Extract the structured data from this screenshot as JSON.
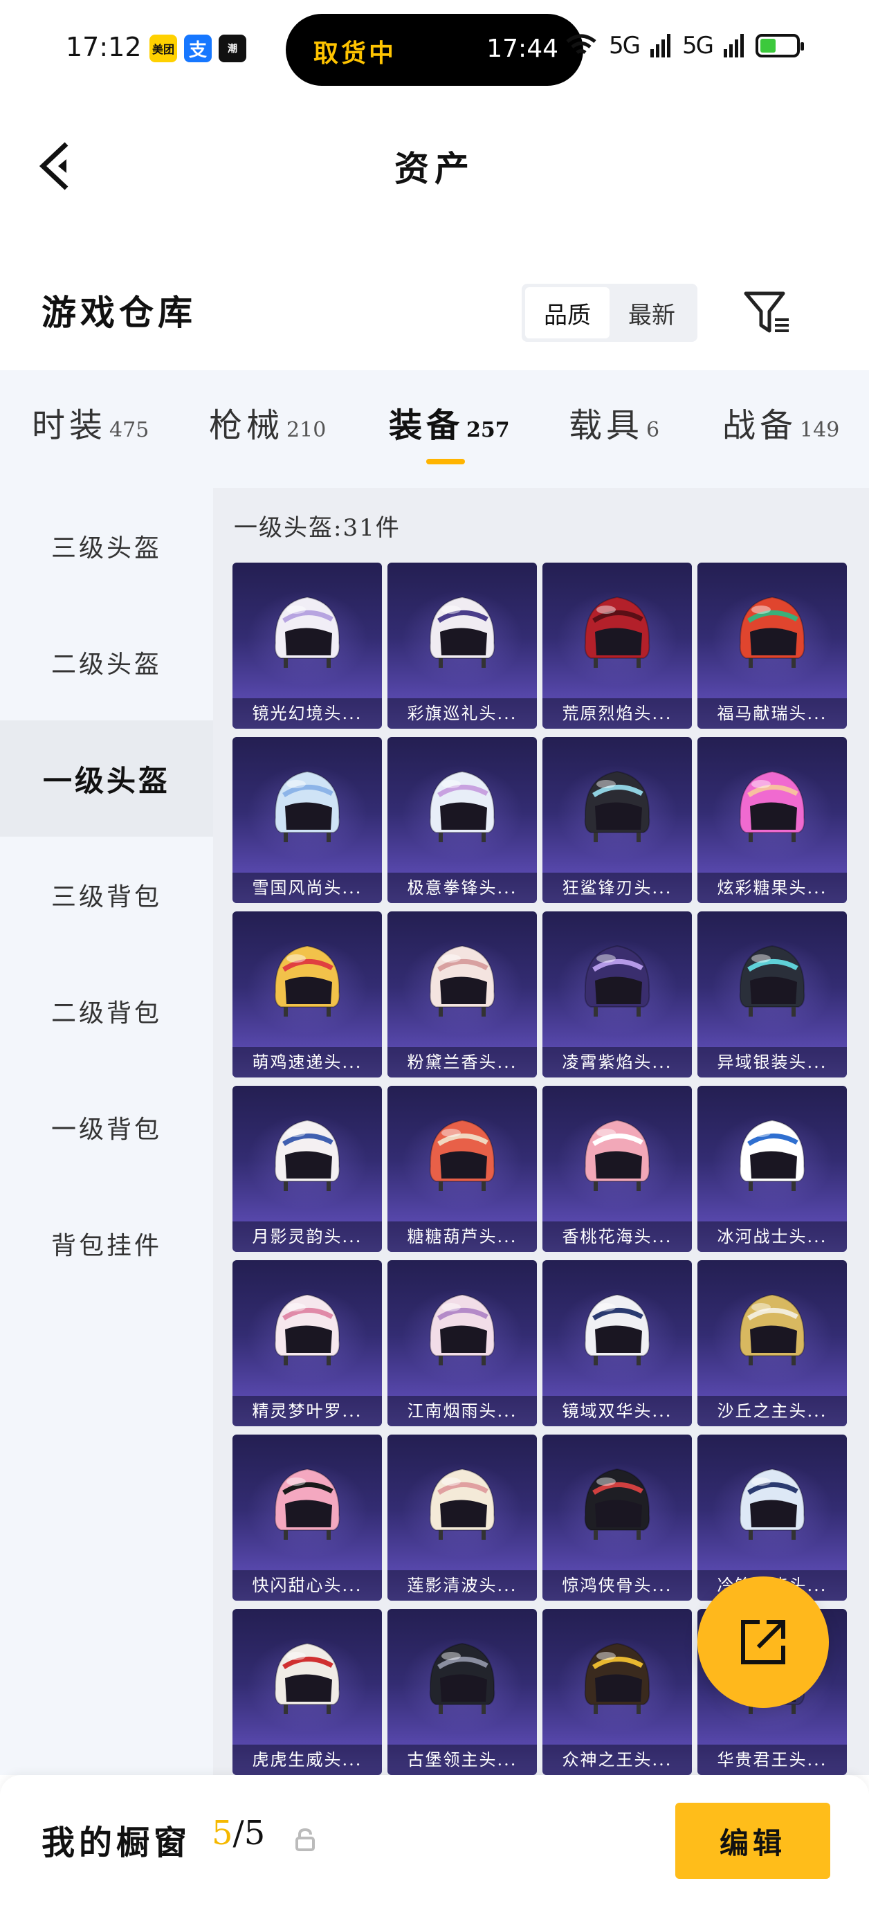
{
  "status_bar": {
    "time": "17:12",
    "badges": [
      "美团",
      "支",
      "潮"
    ],
    "pill_label": "取货中",
    "pill_time": "17:44",
    "signal_1": "5G",
    "signal_2": "5G"
  },
  "nav": {
    "title": "资产"
  },
  "section": {
    "title": "游戏仓库",
    "sort_options": [
      {
        "label": "品质",
        "active": true
      },
      {
        "label": "最新",
        "active": false
      }
    ]
  },
  "tabs": [
    {
      "name": "时装",
      "count": "475"
    },
    {
      "name": "枪械",
      "count": "210"
    },
    {
      "name": "装备",
      "count": "257",
      "active": true
    },
    {
      "name": "载具",
      "count": "6"
    },
    {
      "name": "战备",
      "count": "149"
    }
  ],
  "sidebar": [
    {
      "label": "三级头盔"
    },
    {
      "label": "二级头盔"
    },
    {
      "label": "一级头盔",
      "active": true
    },
    {
      "label": "三级背包"
    },
    {
      "label": "二级背包"
    },
    {
      "label": "一级背包"
    },
    {
      "label": "背包挂件"
    }
  ],
  "grid": {
    "label": "一级头盔:31件",
    "items": [
      {
        "name": "镜光幻境头...",
        "color": "#f1eef6",
        "accent": "#b7a4e0"
      },
      {
        "name": "彩旗巡礼头...",
        "color": "#f0ecf2",
        "accent": "#4a3d8a"
      },
      {
        "name": "荒原烈焰头...",
        "color": "#b3202a",
        "accent": "#5a0f16"
      },
      {
        "name": "福马献瑞头...",
        "color": "#e0452e",
        "accent": "#3ab07a"
      },
      {
        "name": "雪国风尚头...",
        "color": "#cfe3f6",
        "accent": "#8db4e8"
      },
      {
        "name": "极意拳锋头...",
        "color": "#e8eef8",
        "accent": "#c8a2e0"
      },
      {
        "name": "狂鲨锋刃头...",
        "color": "#2b2b33",
        "accent": "#8fd0e0"
      },
      {
        "name": "炫彩糖果头...",
        "color": "#f06ad0",
        "accent": "#f7c0a0"
      },
      {
        "name": "萌鸡速递头...",
        "color": "#f2c24a",
        "accent": "#e04040"
      },
      {
        "name": "粉黛兰香头...",
        "color": "#f4e4e0",
        "accent": "#d8a0a0"
      },
      {
        "name": "凌霄紫焰头...",
        "color": "#3a2e6e",
        "accent": "#b59ae8"
      },
      {
        "name": "异域银装头...",
        "color": "#2a2f3a",
        "accent": "#5fd0d8"
      },
      {
        "name": "月影灵韵头...",
        "color": "#f4f0f2",
        "accent": "#3f5fb0"
      },
      {
        "name": "糖糖葫芦头...",
        "color": "#e86048",
        "accent": "#f0d8c0"
      },
      {
        "name": "香桃花海头...",
        "color": "#f2a8b8",
        "accent": "#ffffff"
      },
      {
        "name": "冰河战士头...",
        "color": "#ffffff",
        "accent": "#2f6fd0"
      },
      {
        "name": "精灵梦叶罗...",
        "color": "#f6e8ee",
        "accent": "#e08aa8"
      },
      {
        "name": "江南烟雨头...",
        "color": "#f2dde8",
        "accent": "#b48ac8"
      },
      {
        "name": "镜域双华头...",
        "color": "#f0f0f4",
        "accent": "#2a3a70"
      },
      {
        "name": "沙丘之主头...",
        "color": "#d8b860",
        "accent": "#f2ecd8"
      },
      {
        "name": "快闪甜心头...",
        "color": "#f4a8c0",
        "accent": "#1a1a1a"
      },
      {
        "name": "莲影清波头...",
        "color": "#f4ead8",
        "accent": "#e0a0a0"
      },
      {
        "name": "惊鸿侠骨头...",
        "color": "#1e1e24",
        "accent": "#d04040"
      },
      {
        "name": "冷锋寒晓头...",
        "color": "#dde8f6",
        "accent": "#2a3a70"
      },
      {
        "name": "虎虎生威头...",
        "color": "#f0ece6",
        "accent": "#d03030"
      },
      {
        "name": "古堡领主头...",
        "color": "#22242c",
        "accent": "#8a8ea0"
      },
      {
        "name": "众神之王头...",
        "color": "#3a2a1e",
        "accent": "#e8b830"
      },
      {
        "name": "华贵君王头...",
        "color": "#3a3470",
        "accent": "#d8c070"
      }
    ]
  },
  "bottom": {
    "title": "我的橱窗",
    "count_current": "5",
    "count_total": "/5",
    "edit_label": "编辑"
  }
}
